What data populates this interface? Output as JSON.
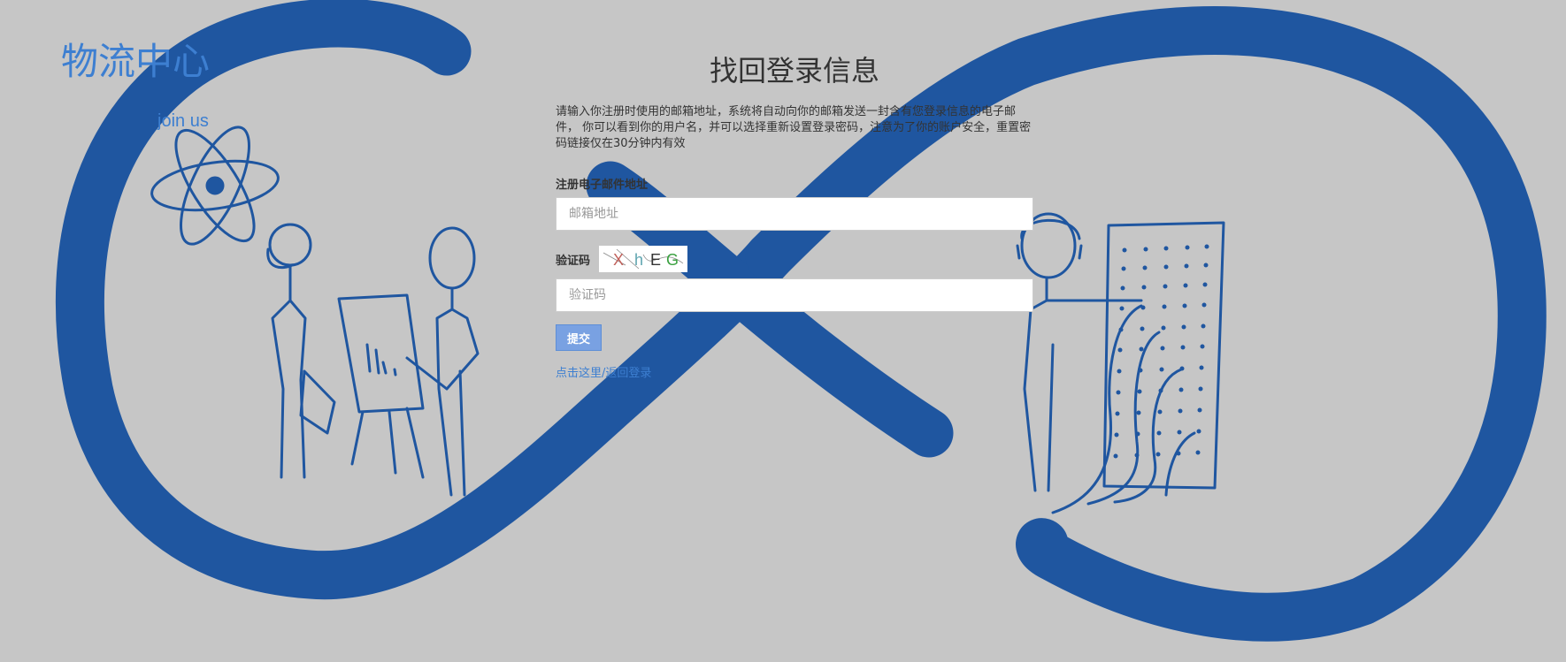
{
  "brand": {
    "title": "物流中心",
    "join_link": "join  us"
  },
  "recover": {
    "title": "找回登录信息",
    "description": "请输入你注册时使用的邮箱地址，系统将自动向你的邮箱发送一封含有您登录信息的电子邮件，  你可以看到你的用户名，并可以选择重新设置登录密码，注意为了你的账户安全，重置密码链接仅在30分钟内有效",
    "email_label": "注册电子邮件地址",
    "email_placeholder": "邮箱地址",
    "captcha_label": "验证码",
    "captcha_text": "XhEG",
    "captcha_placeholder": "验证码",
    "submit_label": "提交",
    "back_link": "点击这里/返回登录"
  },
  "colors": {
    "background": "#c6c6c6",
    "illustration_blue": "#1f56a0",
    "brand_blue": "#3d7fd1",
    "button_blue": "#79a1e2"
  }
}
